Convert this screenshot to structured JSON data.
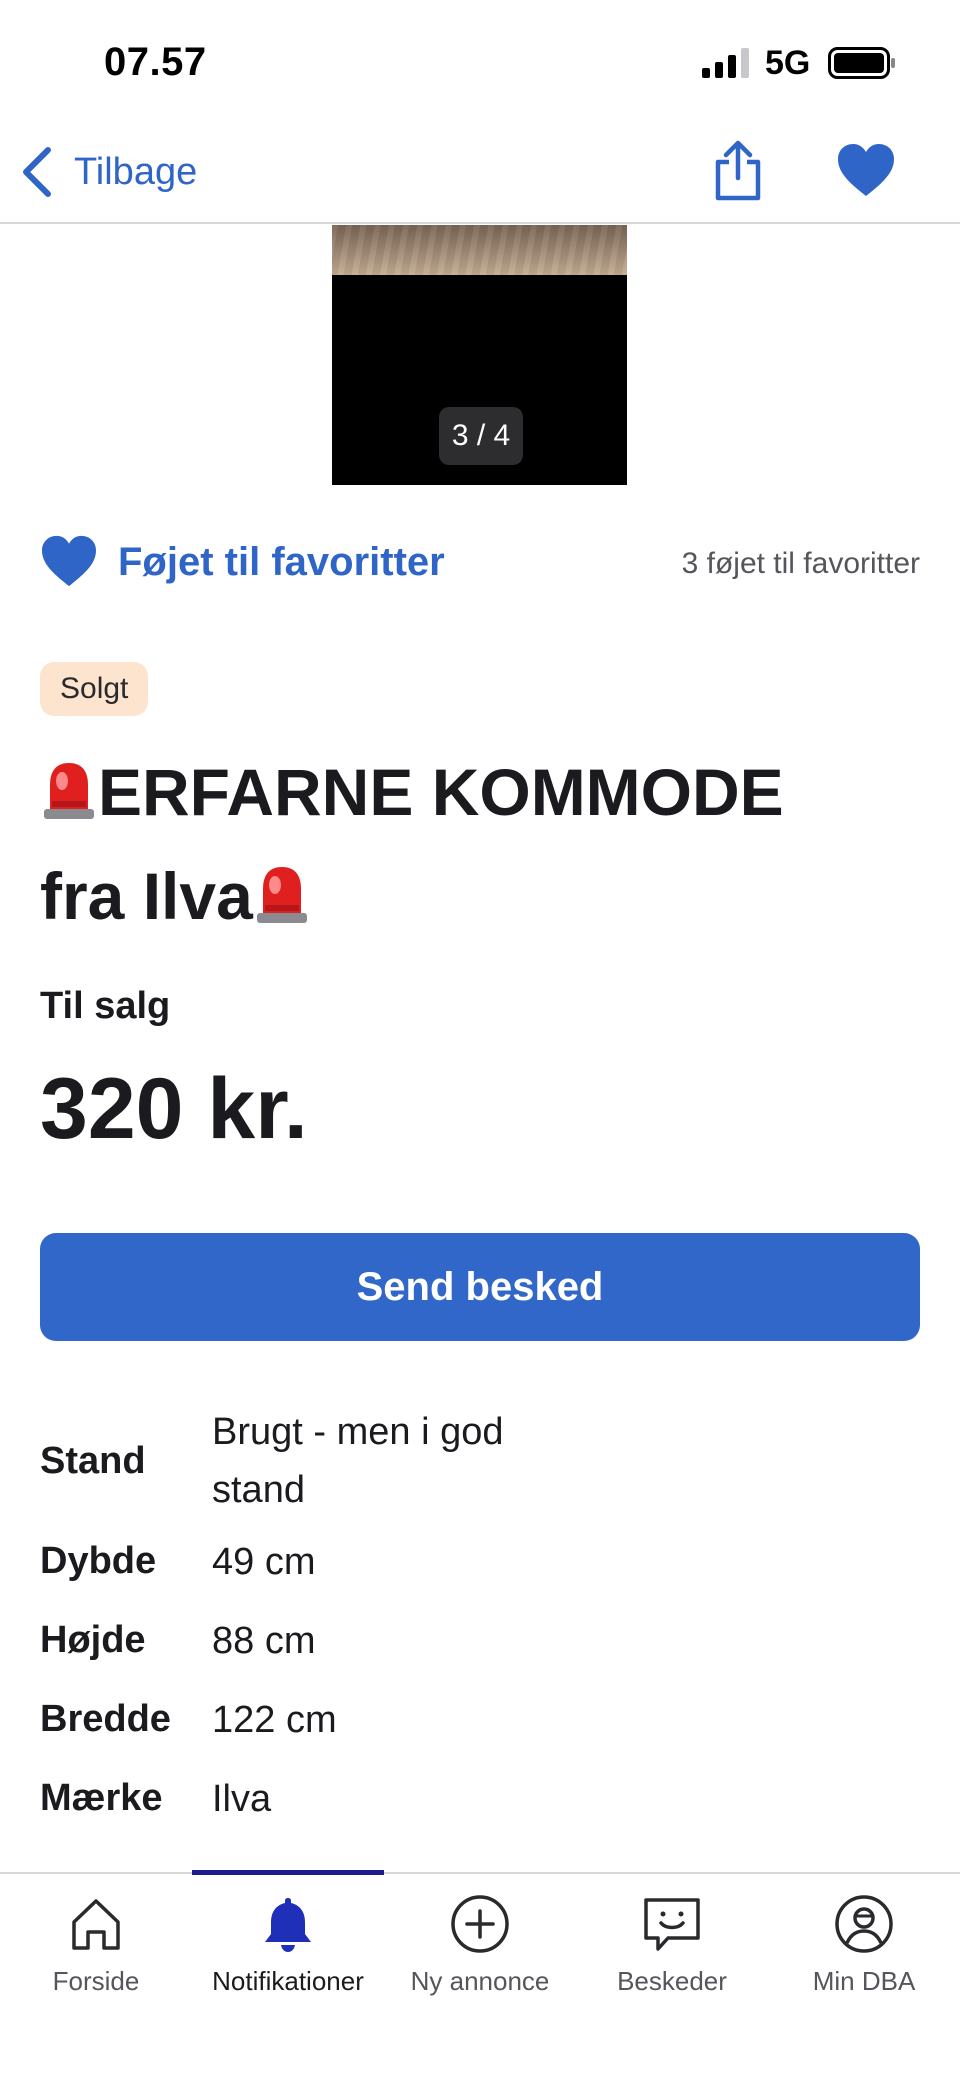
{
  "status_bar": {
    "time": "07.57",
    "network": "5G"
  },
  "nav": {
    "back_label": "Tilbage"
  },
  "gallery": {
    "counter": "3 / 4"
  },
  "favorites": {
    "label": "Føjet til favoritter",
    "count_text": "3 føjet til favoritter"
  },
  "listing": {
    "badge": "Solgt",
    "title_line1": "ERFARNE KOMMODE",
    "title_line2": "fra Ilva",
    "type": "Til salg",
    "price": "320 kr.",
    "send_button": "Send besked"
  },
  "specs": [
    {
      "label": "Stand",
      "value": "Brugt - men i god stand"
    },
    {
      "label": "Dybde",
      "value": "49 cm"
    },
    {
      "label": "Højde",
      "value": "88 cm"
    },
    {
      "label": "Bredde",
      "value": "122 cm"
    },
    {
      "label": "Mærke",
      "value": "Ilva"
    }
  ],
  "tabs": [
    {
      "label": "Forside",
      "icon": "home-icon"
    },
    {
      "label": "Notifikationer",
      "icon": "bell-icon",
      "active": true
    },
    {
      "label": "Ny annonce",
      "icon": "plus-circle-icon"
    },
    {
      "label": "Beskeder",
      "icon": "chat-icon"
    },
    {
      "label": "Min DBA",
      "icon": "profile-icon"
    }
  ],
  "colors": {
    "accent": "#3067c8",
    "badge_bg": "#fde4cf",
    "tab_indicator": "#1a1d8c",
    "bell_active": "#1f2fb8"
  }
}
